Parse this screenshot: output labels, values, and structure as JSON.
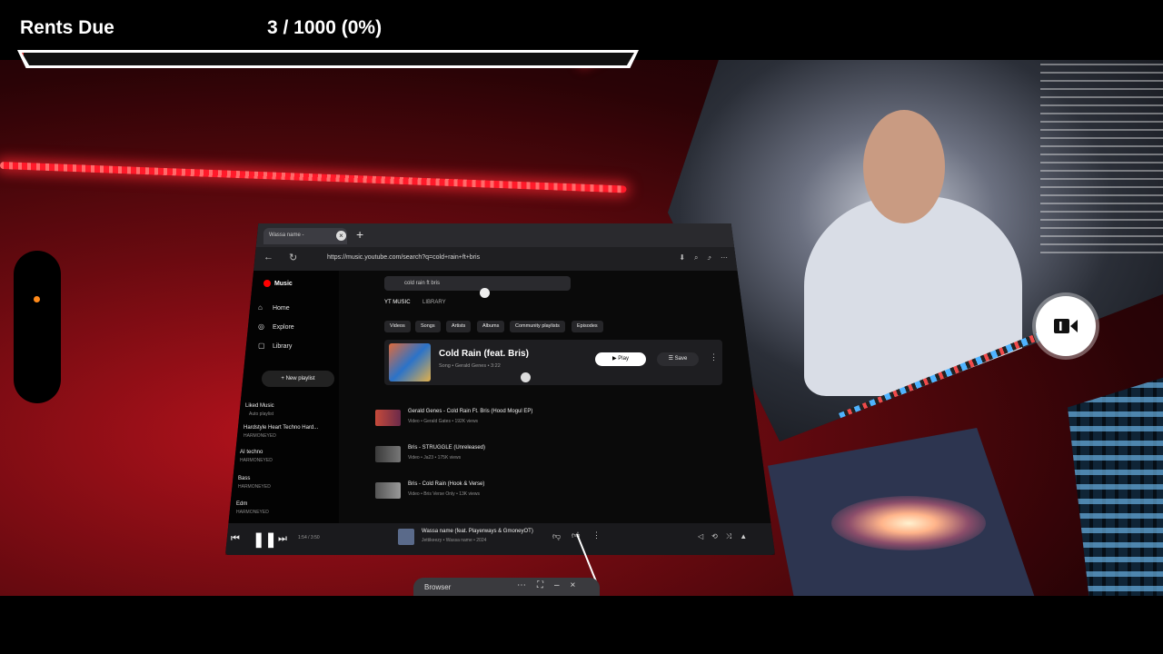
{
  "overlay": {
    "title": "Rents Due",
    "count": "3 / 1000 (0%)",
    "progress_fraction": 0.003,
    "bar_color": "#e53935"
  },
  "colors": {
    "led": "#ff1a2a",
    "brand_red": "#ff0000",
    "controller_dot": "#ff8a1a"
  },
  "browser": {
    "tab_label": "Wassa name -",
    "new_tab_icon": "plus-icon",
    "url": "https://music.youtube.com/search?q=cold+rain+ft+bris",
    "sidebar": {
      "logo": "Music",
      "nav": [
        {
          "label": "Home",
          "icon": "home-icon"
        },
        {
          "label": "Explore",
          "icon": "explore-icon"
        },
        {
          "label": "Library",
          "icon": "library-icon"
        }
      ],
      "new_playlist": "New playlist",
      "playlists": [
        {
          "title": "Liked Music",
          "sub": "Auto playlist"
        },
        {
          "title": "Hardstyle Heart Techno Hard...",
          "sub": "HARMONEYED"
        },
        {
          "title": "AI techno",
          "sub": "HARMONEYED"
        },
        {
          "title": "Bass",
          "sub": "HARMONEYED"
        },
        {
          "title": "Edm",
          "sub": "HARMONEYED"
        }
      ]
    },
    "main": {
      "search_text": "cold rain ft bris",
      "scope_tabs": [
        "YT MUSIC",
        "LIBRARY"
      ],
      "chips": [
        "Videos",
        "Songs",
        "Artists",
        "Albums",
        "Community playlists",
        "Episodes"
      ],
      "top_result": {
        "title": "Cold Rain (feat. Bris)",
        "sub": "Song • Gerald Genes • 3:22",
        "play": "Play",
        "save": "Save"
      },
      "results": [
        {
          "title": "Gerald Genes - Cold Rain Ft. Bris (Hood Mogul EP)",
          "sub": "Video • Gerald Gates • 192K views"
        },
        {
          "title": "Bris - STRUGGLE (Unreleased)",
          "sub": "Video • Ja23 • 175K views"
        },
        {
          "title": "Bris - Cold Rain (Hook & Verse)",
          "sub": "Video • Bris Verse Only • 13K views"
        }
      ]
    },
    "player": {
      "time": "1:54 / 3:50",
      "now_title": "Wassa name (feat. Playerways & GmoneyOT)",
      "now_sub": "Jettikeezy • Wassa name • 2024"
    }
  },
  "taskbar": {
    "label": "Browser"
  }
}
